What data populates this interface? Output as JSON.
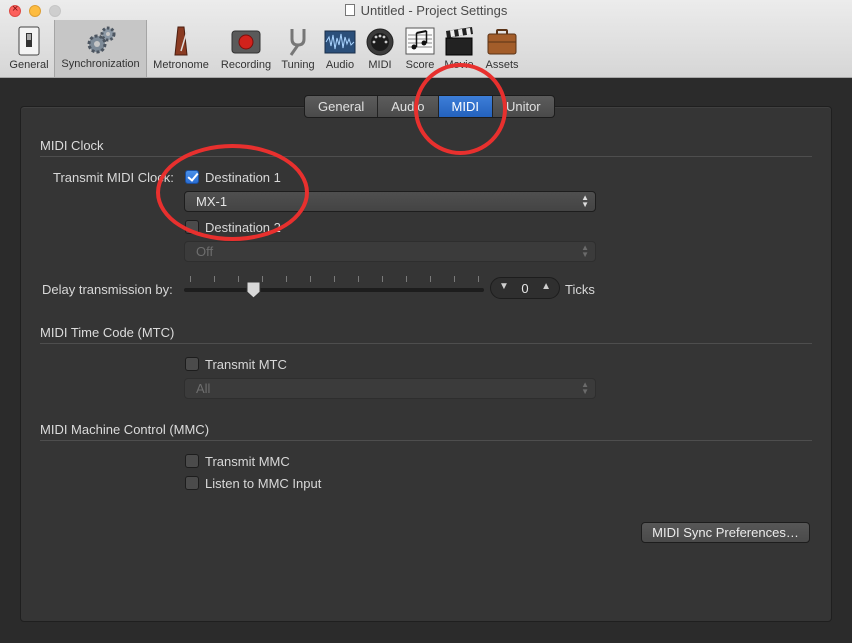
{
  "window": {
    "title": "Untitled - Project Settings"
  },
  "toolbar": {
    "items": [
      {
        "label": "General",
        "icon": "switch-icon"
      },
      {
        "label": "Synchronization",
        "icon": "gears-icon",
        "selected": true
      },
      {
        "label": "Metronome",
        "icon": "metronome-icon"
      },
      {
        "label": "Recording",
        "icon": "record-icon"
      },
      {
        "label": "Tuning",
        "icon": "tuning-fork-icon"
      },
      {
        "label": "Audio",
        "icon": "waveform-icon"
      },
      {
        "label": "MIDI",
        "icon": "midi-port-icon"
      },
      {
        "label": "Score",
        "icon": "music-notes-icon"
      },
      {
        "label": "Movie",
        "icon": "clapperboard-icon"
      },
      {
        "label": "Assets",
        "icon": "briefcase-icon"
      }
    ]
  },
  "tabs": [
    {
      "label": "General"
    },
    {
      "label": "Audio"
    },
    {
      "label": "MIDI",
      "active": true
    },
    {
      "label": "Unitor"
    }
  ],
  "midi_clock": {
    "title": "MIDI Clock",
    "transmit_label": "Transmit MIDI Clock:",
    "destination1": {
      "label": "Destination 1",
      "checked": true,
      "value": "MX-1"
    },
    "destination2": {
      "label": "Destination 2",
      "checked": false,
      "value": "Off"
    },
    "delay_label": "Delay transmission by:",
    "delay_value": "0",
    "delay_unit": "Ticks",
    "delay_slider_position": 0.23
  },
  "mtc": {
    "title": "MIDI Time Code (MTC)",
    "transmit_label": "Transmit MTC",
    "transmit_checked": false,
    "value": "All"
  },
  "mmc": {
    "title": "MIDI Machine Control (MMC)",
    "transmit_label": "Transmit MMC",
    "transmit_checked": false,
    "listen_label": "Listen to MMC Input",
    "listen_checked": false
  },
  "footer": {
    "sync_prefs_label": "MIDI Sync Preferences…"
  },
  "colors": {
    "accent": "#2a6ed4",
    "annotation": "#e8302e",
    "panel": "#353535"
  }
}
